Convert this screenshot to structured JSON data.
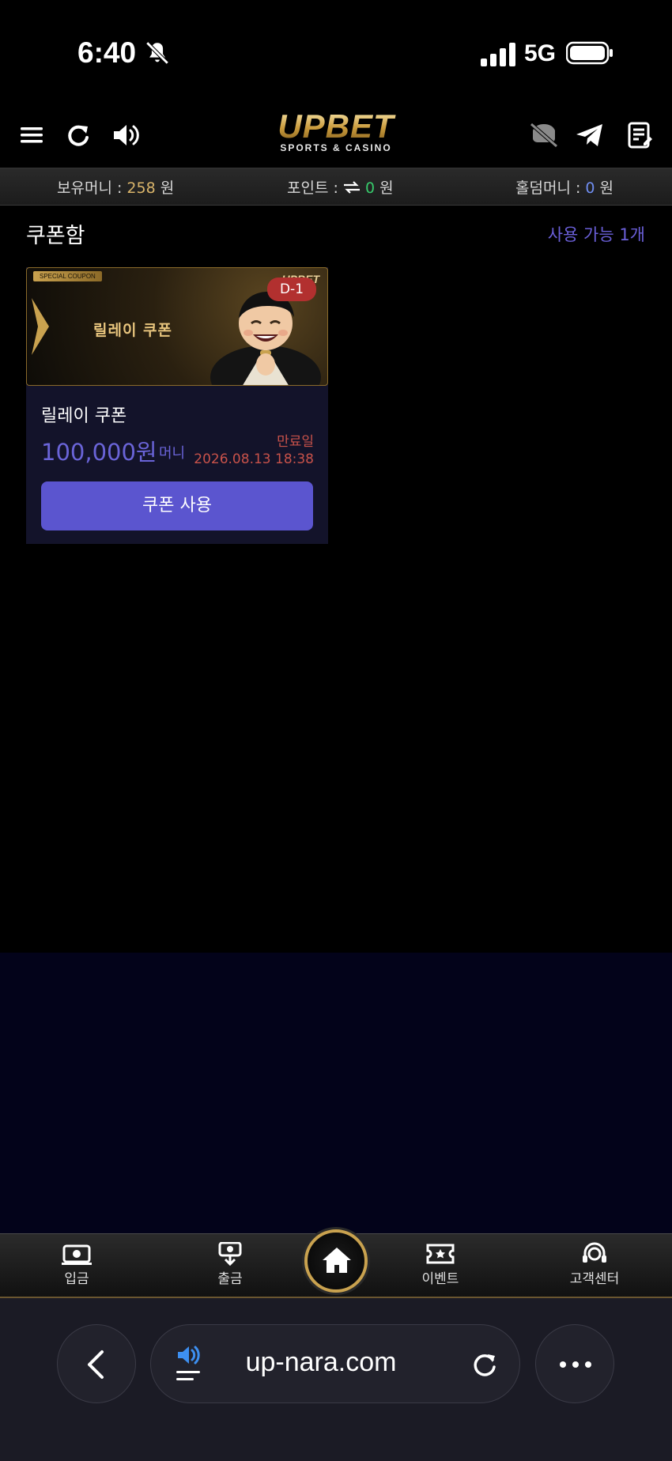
{
  "status_bar": {
    "time": "6:40",
    "network": "5G"
  },
  "header": {
    "logo_main": "UPBET",
    "logo_sub": "SPORTS & CASINO",
    "left_icons": [
      "menu-icon",
      "refresh-icon",
      "speaker-icon"
    ],
    "right_icons": [
      "notification-off-icon",
      "telegram-icon",
      "notes-icon"
    ]
  },
  "balance": {
    "money_label": "보유머니 : ",
    "money_value": "258",
    "money_unit": " 원",
    "points_label": "포인트 : ",
    "points_value": "0",
    "points_unit": " 원",
    "holdem_label": "홀덤머니 : ",
    "holdem_value": "0",
    "holdem_unit": " 원"
  },
  "coupon_box": {
    "title": "쿠폰함",
    "available": "사용 가능 1개",
    "coupons": [
      {
        "banner_tag": "SPECIAL COUPON",
        "banner_title": "릴레이 쿠폰",
        "banner_brand": "UPBET",
        "d_day": "D-1",
        "name": "릴레이 쿠폰",
        "amount": "100,000원",
        "unit": "머니",
        "expiry_label": "만료일",
        "expiry_date": "2026.08.13 18:38",
        "button_label": "쿠폰 사용"
      }
    ]
  },
  "bottom_nav": {
    "items": [
      {
        "label": "입금",
        "icon": "deposit-icon"
      },
      {
        "label": "출금",
        "icon": "withdraw-icon"
      },
      {
        "label": "",
        "icon": "home-icon"
      },
      {
        "label": "이벤트",
        "icon": "ticket-icon"
      },
      {
        "label": "고객센터",
        "icon": "support-icon"
      }
    ]
  },
  "browser": {
    "url": "up-nara.com"
  },
  "colors": {
    "accent": "#5b55cf",
    "gold": "#c9a24f",
    "expiry": "#c8524a",
    "dday": "#b2302f"
  }
}
